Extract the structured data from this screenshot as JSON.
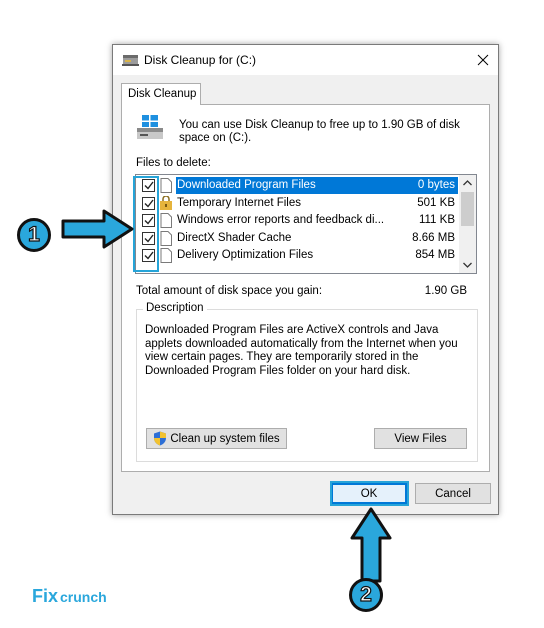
{
  "dialog": {
    "title": "Disk Cleanup for  (C:)",
    "tab_label": "Disk Cleanup",
    "intro_text": "You can use Disk Cleanup to free up to 1.90 GB of disk space on  (C:).",
    "files_label": "Files to delete:",
    "files": [
      {
        "name": "Downloaded Program Files",
        "size": "0 bytes",
        "checked": true,
        "selected": true,
        "icon": "file-icon"
      },
      {
        "name": "Temporary Internet Files",
        "size": "501 KB",
        "checked": true,
        "selected": false,
        "icon": "lock-folder-icon"
      },
      {
        "name": "Windows error reports and feedback di...",
        "size": "111 KB",
        "checked": true,
        "selected": false,
        "icon": "file-icon"
      },
      {
        "name": "DirectX Shader Cache",
        "size": "8.66 MB",
        "checked": true,
        "selected": false,
        "icon": "file-icon"
      },
      {
        "name": "Delivery Optimization Files",
        "size": "854 MB",
        "checked": true,
        "selected": false,
        "icon": "file-icon"
      }
    ],
    "total_label": "Total amount of disk space you gain:",
    "total_value": "1.90 GB",
    "description_legend": "Description",
    "description_text": "Downloaded Program Files are ActiveX controls and Java applets downloaded automatically from the Internet when you view certain pages. They are temporarily stored in the Downloaded Program Files folder on your hard disk.",
    "cleanup_button": "Clean up system files",
    "view_files_button": "View Files",
    "ok_button": "OK",
    "cancel_button": "Cancel"
  },
  "annotations": {
    "step1": "1",
    "step2": "2",
    "accent_color": "#2aa7dc"
  },
  "logo": {
    "text": "Fixcrunch",
    "color": "#2aa7dc"
  }
}
